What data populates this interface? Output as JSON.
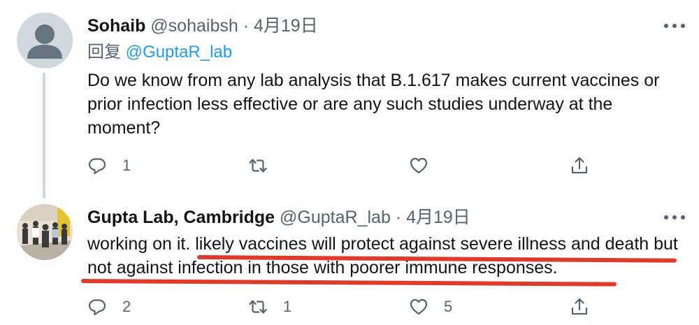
{
  "tweets": [
    {
      "display_name": "Sohaib",
      "handle": "@sohaibsh",
      "separator": "·",
      "date": "4月19日",
      "reply_to_label": "回复",
      "reply_to_mention": "@GuptaR_lab",
      "text": "Do we know from any lab analysis that B.1.617 makes current vaccines or prior infection less effective or are any such studies underway at the moment?",
      "actions": {
        "replies": "1",
        "retweets": "",
        "likes": "",
        "share": ""
      },
      "avatar_icon": "default-profile-icon"
    },
    {
      "display_name": "Gupta Lab, Cambridge",
      "handle": "@GuptaR_lab",
      "separator": "·",
      "date": "4月19日",
      "text": "working on it. likely vaccines will protect against severe illness and death but not against infection in those with poorer immune responses.",
      "actions": {
        "replies": "2",
        "retweets": "1",
        "likes": "5",
        "share": ""
      },
      "avatar_icon": "group-photo-avatar"
    }
  ],
  "icons": {
    "reply": "reply-icon",
    "retweet": "retweet-icon",
    "like": "heart-icon",
    "share": "share-icon",
    "more": "more-icon"
  },
  "colors": {
    "link": "#1d9bf0",
    "muted": "#536471",
    "text": "#0f1419",
    "annotation": "#e03a2b",
    "thread_line": "#cfd9de"
  }
}
